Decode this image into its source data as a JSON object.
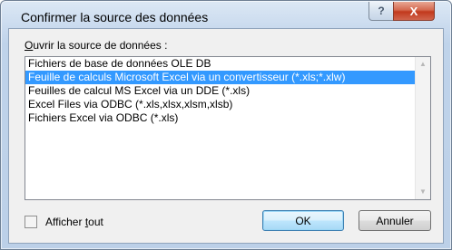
{
  "window": {
    "title": "Confirmer la source des données",
    "help_label": "?",
    "close_label": "X"
  },
  "list": {
    "label_prefix": "",
    "label_accel": "O",
    "label_rest": "uvrir la source de données :",
    "items": [
      {
        "label": "Fichiers de base de données OLE DB"
      },
      {
        "label": "Feuille de calculs Microsoft Excel via un convertisseur (*.xls;*.xlw)",
        "selected": true
      },
      {
        "label": "Feuilles de calcul MS Excel via un DDE (*.xls)"
      },
      {
        "label": "Excel Files via ODBC (*.xls,xlsx,xlsm,xlsb)"
      },
      {
        "label": "Fichiers Excel via ODBC (*.xls)"
      }
    ]
  },
  "options": {
    "show_all_prefix": "Afficher ",
    "show_all_accel": "t",
    "show_all_rest": "out",
    "show_all_checked": false
  },
  "buttons": {
    "ok": "OK",
    "cancel": "Annuler"
  },
  "colors": {
    "selection": "#3399ff",
    "close_button": "#c2391d"
  }
}
